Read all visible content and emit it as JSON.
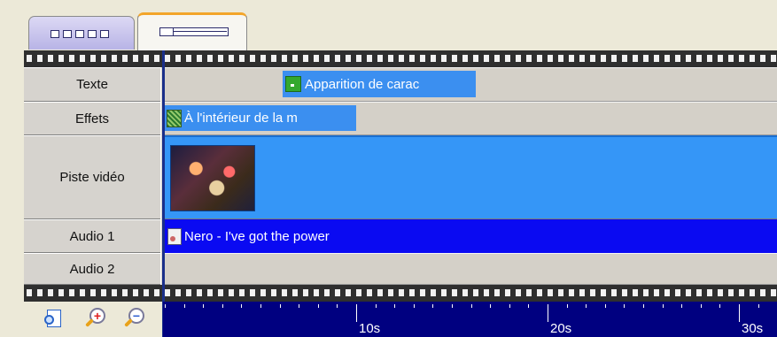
{
  "tabs": [
    {
      "name": "storyboard",
      "icon": "storyboard-icon"
    },
    {
      "name": "timeline",
      "icon": "timeline-icon",
      "selected": true
    }
  ],
  "tracks": {
    "texte": {
      "label": "Texte",
      "clip": "Apparition de carac"
    },
    "effets": {
      "label": "Effets",
      "clip": "À l'intérieur de la m"
    },
    "video": {
      "label": "Piste vidéo"
    },
    "audio1": {
      "label": "Audio 1",
      "clip": "Nero -  I've got the power"
    },
    "audio2": {
      "label": "Audio 2"
    }
  },
  "ruler": {
    "labels": [
      "10s",
      "20s",
      "30s"
    ]
  },
  "zoom": {
    "buttons": [
      "zoom-fit-icon",
      "zoom-in-icon",
      "zoom-out-icon"
    ]
  },
  "colors": {
    "video_track": "#3596f7",
    "audio_track": "#0a0af2",
    "ruler": "#000080",
    "tab_accent": "#f3a52a"
  }
}
